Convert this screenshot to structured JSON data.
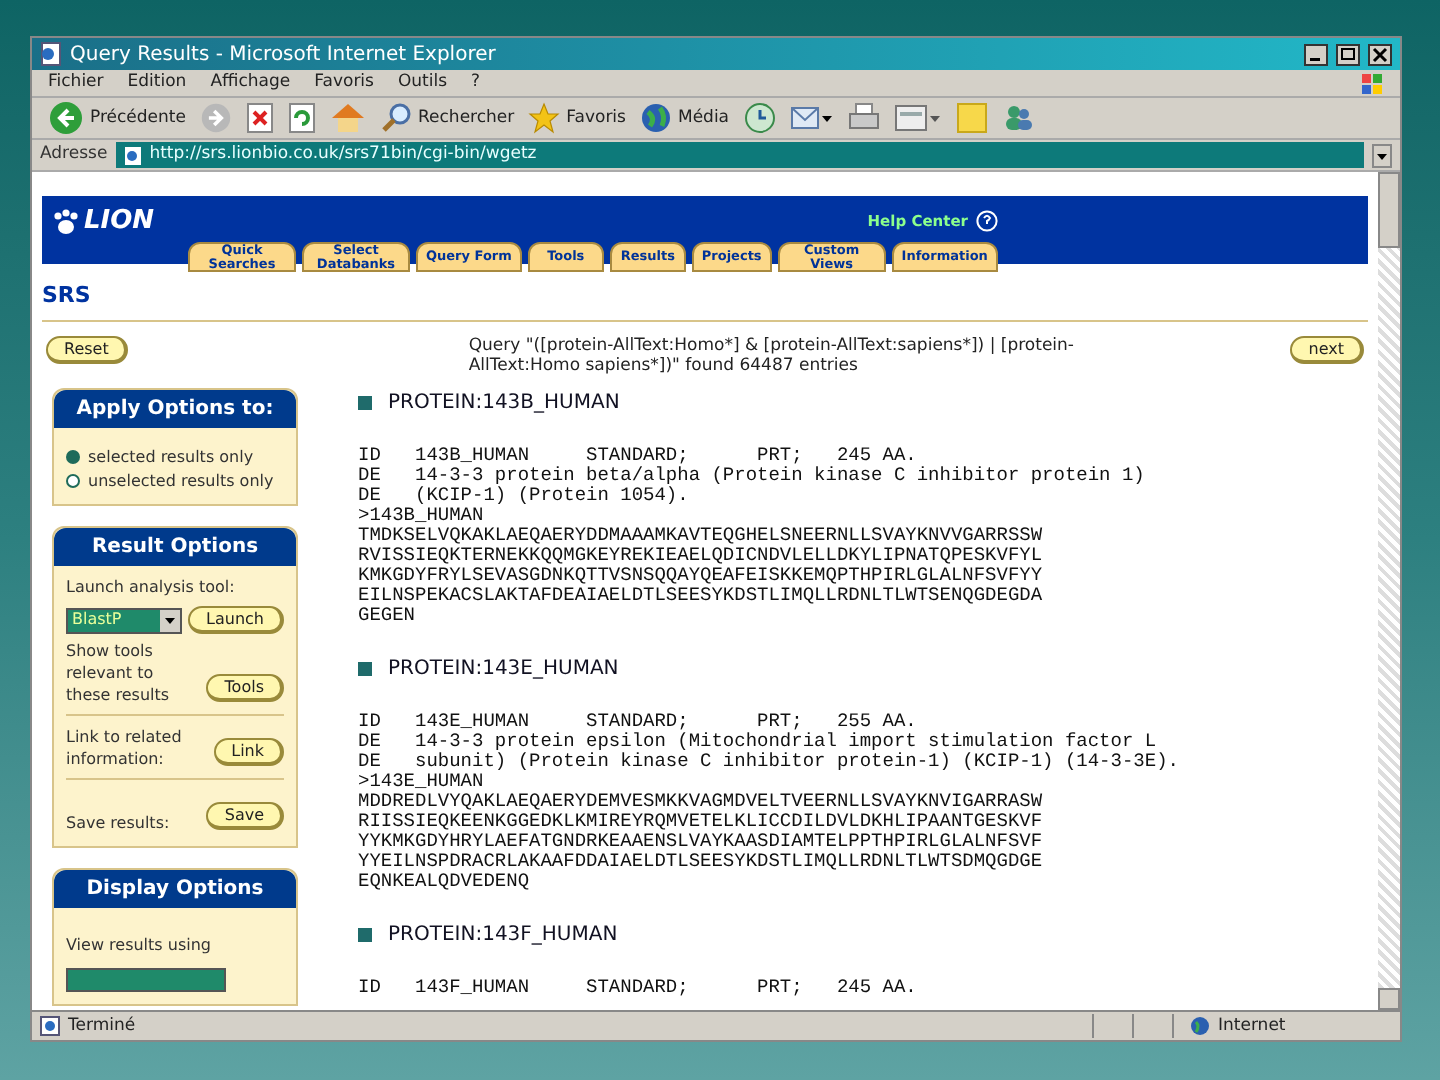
{
  "window": {
    "title": "Query Results - Microsoft Internet Explorer"
  },
  "menu": [
    "Fichier",
    "Edition",
    "Affichage",
    "Favoris",
    "Outils",
    "?"
  ],
  "toolbar": [
    {
      "kind": "back",
      "label": "Précédente"
    },
    {
      "kind": "forward"
    },
    {
      "kind": "stop"
    },
    {
      "kind": "refresh"
    },
    {
      "kind": "home"
    },
    {
      "kind": "search",
      "label": "Rechercher"
    },
    {
      "kind": "favorites",
      "label": "Favoris"
    },
    {
      "kind": "media",
      "label": "Média"
    },
    {
      "kind": "history"
    },
    {
      "kind": "mail"
    },
    {
      "kind": "print"
    },
    {
      "kind": "edit"
    },
    {
      "kind": "folder"
    },
    {
      "kind": "messenger"
    }
  ],
  "address": {
    "label": "Adresse",
    "value": "http://srs.lionbio.co.uk/srs71bin/cgi-bin/wgetz"
  },
  "site": {
    "logo": "LION",
    "help": "Help Center",
    "tabs": [
      "Quick Searches",
      "Select Databanks",
      "Query Form",
      "Tools",
      "Results",
      "Projects",
      "Custom Views",
      "Information"
    ],
    "section": "SRS",
    "reset": "Reset",
    "next": "next",
    "query": "Query \"([protein-AllText:Homo*] & [protein-AllText:sapiens*]) | [protein-AllText:Homo sapiens*])\" found 64487 entries"
  },
  "apply_options": {
    "title": "Apply Options to:",
    "options": [
      {
        "label": "selected results only",
        "selected": true
      },
      {
        "label": "unselected results only",
        "selected": false
      }
    ]
  },
  "result_options": {
    "title": "Result Options",
    "launch_label": "Launch analysis tool:",
    "tool": "BlastP",
    "launch_button": "Launch",
    "items": [
      {
        "label": "Show tools relevant to these results",
        "button": "Tools"
      },
      {
        "label": "Link to related information:",
        "button": "Link"
      },
      {
        "label": "Save results:",
        "button": "Save"
      }
    ]
  },
  "display_options": {
    "title": "Display Options",
    "label": "View results using"
  },
  "entries": [
    {
      "heading": "PROTEIN:143B_HUMAN",
      "lines": [
        "ID   143B_HUMAN     STANDARD;      PRT;   245 AA.",
        "DE   14-3-3 protein beta/alpha (Protein kinase C inhibitor protein 1)",
        "DE   (KCIP-1) (Protein 1054).",
        ">143B_HUMAN",
        "TMDKSELVQKAKLAEQAERYDDMAAAMKAVTEQGHELSNEERNLLSVAYKNVVGARRSSW",
        "RVISSIEQKTERNEKKQQMGKEYREKIEAELQDICNDVLELLDKYLIPNATQPESKVFYL",
        "KMKGDYFRYLSEVASGDNKQTTVSNSQQAYQEAFEISKKEMQPTHPIRLGLALNFSVFYY",
        "EILNSPEKACSLAKTAFDEAIAELDTLSEESYKDSTLIMQLLRDNLTLWTSENQGDEGDA",
        "GEGEN"
      ]
    },
    {
      "heading": "PROTEIN:143E_HUMAN",
      "lines": [
        "ID   143E_HUMAN     STANDARD;      PRT;   255 AA.",
        "DE   14-3-3 protein epsilon (Mitochondrial import stimulation factor L",
        "DE   subunit) (Protein kinase C inhibitor protein-1) (KCIP-1) (14-3-3E).",
        ">143E_HUMAN",
        "MDDREDLVYQAKLAEQAERYDEMVESMKKVAGMDVELTVEERNLLSVAYKNVIGARRASW",
        "RIISSIEQKEENKGGEDKLKMIREYRQMVETELKLICCDILDVLDKHLIPAANTGESKVF",
        "YYKMKGDYHRYLAEFATGNDRKEAAENSLVAYKAASDIAMTELPPTHPIRLGLALNFSVF",
        "YYEILNSPDRACRLAKAAFDDAIAELDTLSEESYKDSTLIMQLLRDNLTLWTSDMQGDGE",
        "EQNKEALQDVEDENQ"
      ]
    },
    {
      "heading": "PROTEIN:143F_HUMAN",
      "lines": [
        "ID   143F_HUMAN     STANDARD;      PRT;   245 AA."
      ]
    }
  ],
  "status_bar": {
    "text": "Terminé",
    "zone": "Internet"
  }
}
